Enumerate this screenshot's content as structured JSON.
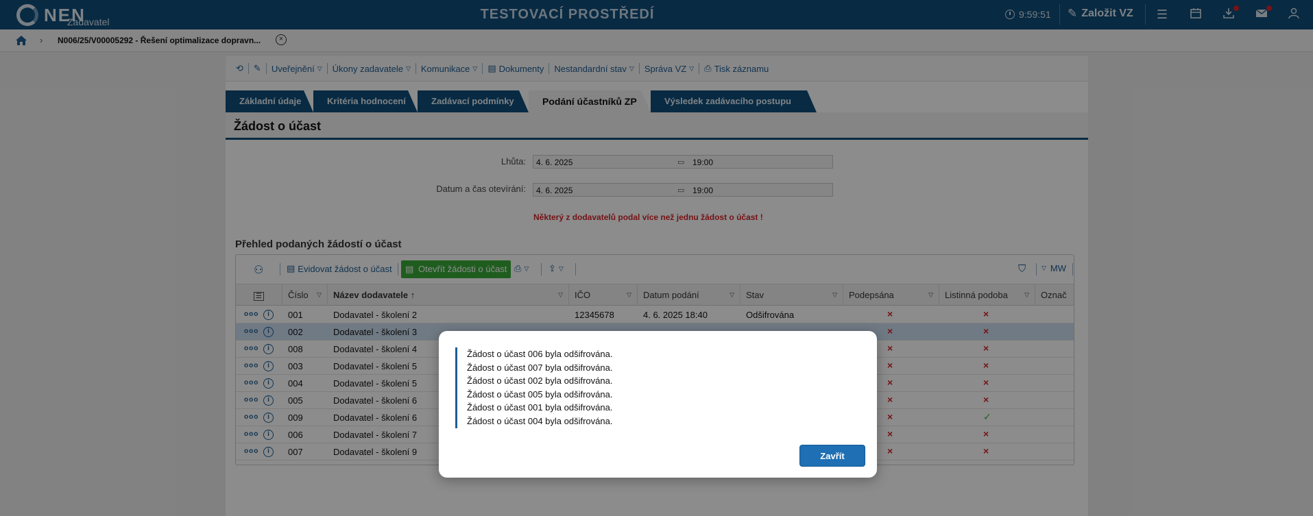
{
  "header": {
    "logo_text": "NEN",
    "logo_sub": "Zadavatel",
    "environment_title": "TESTOVACÍ PROSTŘEDÍ",
    "clock": "9:59:51",
    "create_vz_label": "Založit VZ"
  },
  "breadcrumb": {
    "current": "N006/25/V00005292 - Řešení optimalizace dopravn..."
  },
  "toolbar": {
    "items": [
      "Uveřejnění",
      "Úkony zadavatele",
      "Komunikace",
      "Dokumenty",
      "Nestandardní stav",
      "Správa VZ",
      "Tisk záznamu"
    ]
  },
  "tabs": [
    "Základní údaje",
    "Kritéria hodnocení",
    "Zadávací podmínky",
    "Podání účastníků ZP",
    "Výsledek zadávacího postupu"
  ],
  "active_tab": "Podání účastníků ZP",
  "section_title": "Žádost o účast",
  "fields": {
    "deadline_label": "Lhůta:",
    "deadline_date": "4. 6. 2025",
    "deadline_time": "19:00",
    "opening_label": "Datum a čas otevírání:",
    "opening_date": "4. 6. 2025",
    "opening_time": "19:00"
  },
  "warning": "Některý z dodavatelů podal více než jednu žádost o účast !",
  "overview_title": "Přehled podaných žádostí o účast",
  "grid": {
    "tools": {
      "register": "Evidovat žádost o účast",
      "open": "Otevřít žádosti o účast",
      "mw": "MW"
    },
    "columns": [
      "Číslo",
      "Název dodavatele",
      "IČO",
      "Datum podání",
      "Stav",
      "Podepsána",
      "Listinná podoba",
      "Označ"
    ],
    "rows": [
      {
        "cislo": "001",
        "nazev": "Dodavatel - školení 2",
        "ico": "12345678",
        "datum": "4. 6. 2025 18:40",
        "stav": "Odšifrována",
        "podepsana": "x",
        "listinna": "x"
      },
      {
        "cislo": "002",
        "nazev": "Dodavatel - školení 3",
        "ico": "",
        "datum": "",
        "stav": "",
        "podepsana": "x",
        "listinna": "x"
      },
      {
        "cislo": "008",
        "nazev": "Dodavatel - školení 4",
        "ico": "",
        "datum": "",
        "stav": "",
        "podepsana": "x",
        "listinna": "x"
      },
      {
        "cislo": "003",
        "nazev": "Dodavatel - školení 5",
        "ico": "",
        "datum": "",
        "stav": "",
        "podepsana": "x",
        "listinna": "x"
      },
      {
        "cislo": "004",
        "nazev": "Dodavatel - školení 5",
        "ico": "",
        "datum": "",
        "stav": "",
        "podepsana": "x",
        "listinna": "x"
      },
      {
        "cislo": "005",
        "nazev": "Dodavatel - školení 6",
        "ico": "",
        "datum": "",
        "stav": "",
        "podepsana": "x",
        "listinna": "x"
      },
      {
        "cislo": "009",
        "nazev": "Dodavatel - školení 6",
        "ico": "",
        "datum": "",
        "stav": "",
        "podepsana": "x",
        "listinna": "check"
      },
      {
        "cislo": "006",
        "nazev": "Dodavatel - školení 7",
        "ico": "",
        "datum": "",
        "stav": "",
        "podepsana": "x",
        "listinna": "x"
      },
      {
        "cislo": "007",
        "nazev": "Dodavatel - školení 9",
        "ico": "",
        "datum": "",
        "stav": "",
        "podepsana": "x",
        "listinna": "x"
      }
    ],
    "selected_row": 1
  },
  "modal": {
    "messages": [
      "Žádost o účast 006 byla odšifrována.",
      "Žádost o účast 007 byla odšifrována.",
      "Žádost o účast 002 byla odšifrována.",
      "Žádost o účast 005 byla odšifrována.",
      "Žádost o účast 001 byla odšifrována.",
      "Žádost o účast 004 byla odšifrována."
    ],
    "close_label": "Zavřít"
  },
  "colors": {
    "brand": "#0f4d7a",
    "link": "#1e5d93",
    "error": "#d8232a",
    "success": "#3aa93a",
    "primary_button": "#1e6fb4"
  }
}
